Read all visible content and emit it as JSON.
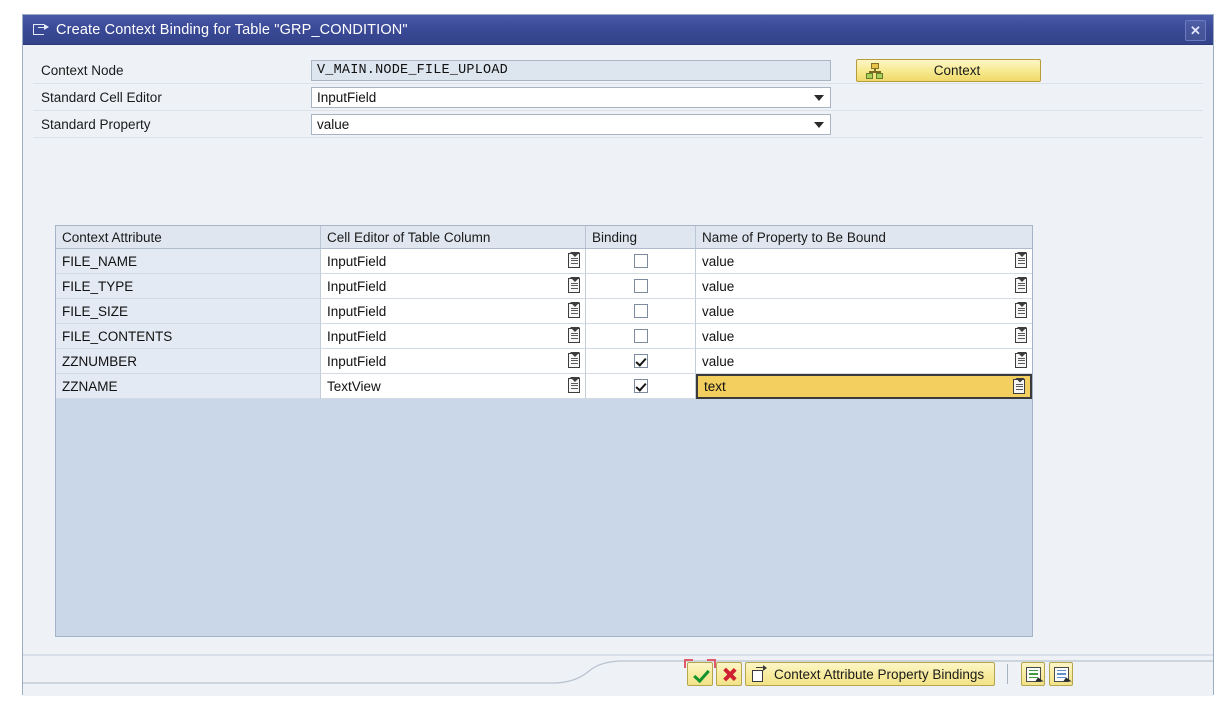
{
  "dialog": {
    "title": "Create Context Binding for Table \"GRP_CONDITION\"",
    "close_label": "✕"
  },
  "form": {
    "rows": [
      {
        "label": "Context Node",
        "value": "V_MAIN.NODE_FILE_UPLOAD",
        "type": "readonly"
      },
      {
        "label": "Standard Cell Editor",
        "value": "InputField",
        "type": "combo"
      },
      {
        "label": "Standard Property",
        "value": "value",
        "type": "combo"
      }
    ],
    "context_button": "Context"
  },
  "table": {
    "headers": [
      "Context Attribute",
      "Cell Editor of Table Column",
      "Binding",
      "Name of Property to Be Bound"
    ],
    "rows": [
      {
        "attribute": "FILE_NAME",
        "editor": "InputField",
        "binding": false,
        "property": "value",
        "selected": false
      },
      {
        "attribute": "FILE_TYPE",
        "editor": "InputField",
        "binding": false,
        "property": "value",
        "selected": false
      },
      {
        "attribute": "FILE_SIZE",
        "editor": "InputField",
        "binding": false,
        "property": "value",
        "selected": false
      },
      {
        "attribute": "FILE_CONTENTS",
        "editor": "InputField",
        "binding": false,
        "property": "value",
        "selected": false
      },
      {
        "attribute": "ZZNUMBER",
        "editor": "InputField",
        "binding": true,
        "property": "value",
        "selected": false
      },
      {
        "attribute": "ZZNAME",
        "editor": "TextView",
        "binding": true,
        "property": "text",
        "selected": true
      }
    ]
  },
  "footer": {
    "confirm_label": "",
    "cancel_label": "",
    "bindings_button": "Context Attribute Property Bindings"
  },
  "colors": {
    "titlebar": "#3b4a97",
    "dialog_bg": "#eef2f7",
    "table_bg": "#c9d7e8",
    "header_bg": "#dfe6ef",
    "attr_cell_bg": "#e4eaf3",
    "selected_cell": "#f3cf5f",
    "button_yellow": "#f7e98e",
    "confirm_green": "#14932e",
    "cancel_red": "#cf2031",
    "focus_red": "#e05a6a"
  }
}
